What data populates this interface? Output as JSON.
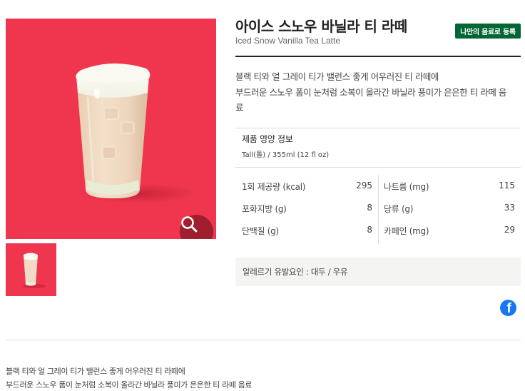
{
  "product": {
    "name_ko": "아이스 스노우 바닐라 티 라떼",
    "name_en": "Iced Snow Vanilla Tea Latte",
    "register_label": "나만의 음료로 등록",
    "description_lines": [
      "블랙 티와 얼 그레이 티가 밸런스 좋게 어우러진 티 라떼에",
      "부드러운 스노우 폼이 눈처럼 소복이 올라간 바닐라 풍미가 은은한 티 라떼 음",
      "료"
    ]
  },
  "media": {
    "main_image": "iced-tea-latte-photo",
    "zoom_icon": "magnifier-icon",
    "thumbnail": "iced-tea-latte-thumbnail"
  },
  "nutrition": {
    "title": "제품 영양 정보",
    "serving": "Tall(톨) / 355ml (12 fl oz)",
    "left": [
      {
        "label": "1회 제공량 (kcal)",
        "value": "295"
      },
      {
        "label": "포화지방 (g)",
        "value": "8"
      },
      {
        "label": "단백질 (g)",
        "value": "8"
      }
    ],
    "right": [
      {
        "label": "나트륨 (mg)",
        "value": "115"
      },
      {
        "label": "당류 (g)",
        "value": "33"
      },
      {
        "label": "카페인 (mg)",
        "value": "29"
      }
    ]
  },
  "allergy": {
    "text": "알레르기 유발요인 : 대두 / 우유"
  },
  "share": {
    "facebook_icon": "facebook-icon"
  },
  "bottom_description": [
    "블랙 티와 얼 그레이 티가 밸런스 좋게 어우러진 티 라떼에",
    "부드러운 스노우 폼이 눈처럼 소복이 올라간 바닐라 풍미가 은은한 티 라떼 음료"
  ],
  "colors": {
    "image_background": "#f0364e",
    "brand_green": "#006633",
    "zoom_circle": "#9f1f2f",
    "facebook_blue": "#1877f2"
  }
}
